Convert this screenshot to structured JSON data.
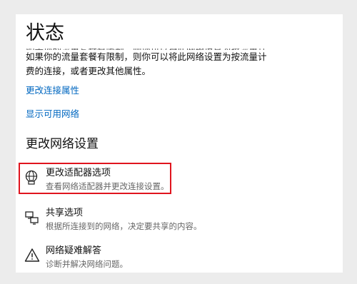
{
  "page": {
    "title": "状态",
    "cut_line": "如果你的流量套餐有限制，则你可以将此网络设置为按流量计",
    "info_line1": "如果你的流量套餐有限制，则你可以将此网络设置为按流量计",
    "info_line2": "费的连接，或者更改其他属性。"
  },
  "links": {
    "change_props": "更改连接属性",
    "show_networks": "显示可用网络"
  },
  "section": {
    "heading": "更改网络设置"
  },
  "options": [
    {
      "title": "更改适配器选项",
      "desc": "查看网络适配器并更改连接设置。",
      "icon": "adapter-icon",
      "highlighted": true
    },
    {
      "title": "共享选项",
      "desc": "根据所连接到的网络，决定要共享的内容。",
      "icon": "sharing-icon"
    },
    {
      "title": "网络疑难解答",
      "desc": "诊断并解决网络问题。",
      "icon": "warning-icon"
    }
  ],
  "colors": {
    "link": "#0067c0",
    "highlight": "#e0141e"
  }
}
